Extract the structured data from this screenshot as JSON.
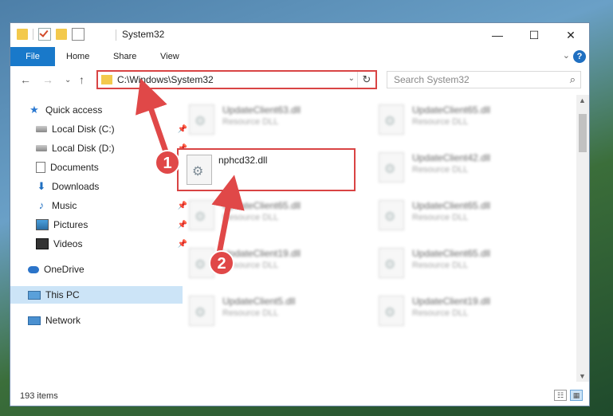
{
  "window": {
    "title": "System32",
    "controls": {
      "minimize": "—",
      "maximize": "☐",
      "close": "✕"
    }
  },
  "ribbon": {
    "tabs": [
      "File",
      "Home",
      "Share",
      "View"
    ],
    "help": "?",
    "expand": "⌄"
  },
  "nav": {
    "back": "←",
    "forward": "→",
    "recent": "⌄",
    "up": "↑",
    "address": "C:\\Windows\\System32",
    "address_dropdown": "⌄",
    "refresh": "↻",
    "search_placeholder": "Search System32",
    "search_icon": "⌕"
  },
  "sidebar": {
    "items": [
      {
        "label": "Quick access",
        "icon": "star-icon"
      },
      {
        "label": "Local Disk (C:)",
        "icon": "disk-icon",
        "pin": "📌"
      },
      {
        "label": "Local Disk (D:)",
        "icon": "disk-icon",
        "pin": "📌"
      },
      {
        "label": "Documents",
        "icon": "document-icon",
        "pin": "📌"
      },
      {
        "label": "Downloads",
        "icon": "download-icon",
        "pin": "📌"
      },
      {
        "label": "Music",
        "icon": "music-icon",
        "pin": "📌"
      },
      {
        "label": "Pictures",
        "icon": "picture-icon",
        "pin": "📌"
      },
      {
        "label": "Videos",
        "icon": "video-icon",
        "pin": "📌"
      },
      {
        "label": "OneDrive",
        "icon": "cloud-icon"
      },
      {
        "label": "This PC",
        "icon": "computer-icon",
        "selected": true
      },
      {
        "label": "Network",
        "icon": "network-icon"
      }
    ]
  },
  "files": {
    "left_column": [
      {
        "name": "UpdateClient63.dll",
        "type": "Resource DLL"
      },
      {
        "name": "UpdateClient65.dll",
        "type": "Resource DLL"
      },
      {
        "name": "UpdateClient19.dll",
        "type": "Resource DLL"
      },
      {
        "name": "UpdateClient5.dll",
        "type": "Resource DLL"
      }
    ],
    "right_column": [
      {
        "name": "UpdateClient65.dll",
        "type": "Resource DLL"
      },
      {
        "name": "UpdateClient42.dll",
        "type": "Resource DLL"
      },
      {
        "name": "UpdateClient65.dll",
        "type": "Resource DLL"
      },
      {
        "name": "UpdateClient65.dll",
        "type": "Resource DLL"
      },
      {
        "name": "UpdateClient19.dll",
        "type": "Resource DLL"
      }
    ],
    "highlighted": {
      "name": "nphcd32.dll"
    }
  },
  "status": {
    "count": "193 items",
    "view_details": "☷",
    "view_tiles": "▦"
  },
  "annotations": {
    "badge1": "1",
    "badge2": "2",
    "color": "#e04848"
  }
}
